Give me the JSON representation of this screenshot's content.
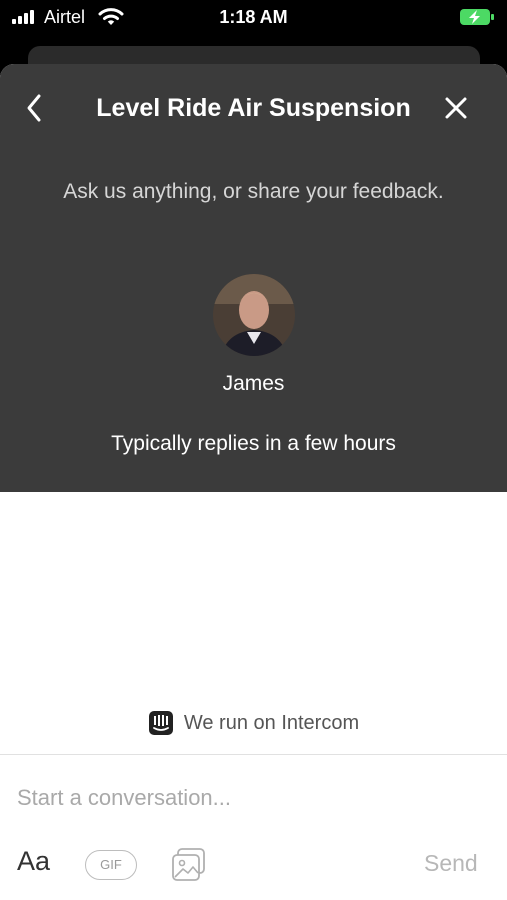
{
  "status_bar": {
    "carrier": "Airtel",
    "time": "1:18 AM"
  },
  "header": {
    "title": "Level Ride Air Suspension",
    "intro": "Ask us anything, or share your feedback.",
    "agent_name": "James",
    "reply_time": "Typically replies in a few hours"
  },
  "powered_by": "We run on Intercom",
  "composer": {
    "placeholder": "Start a conversation...",
    "format_label": "Aa",
    "gif_label": "GIF",
    "send_label": "Send"
  },
  "colors": {
    "header_bg": "#3b3b3b",
    "battery_charging": "#4cd964"
  }
}
